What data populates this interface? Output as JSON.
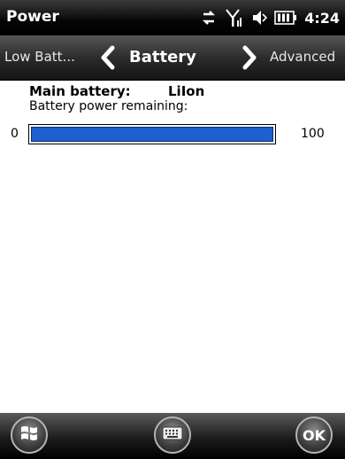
{
  "titlebar": {
    "title": "Power",
    "clock": "4:24",
    "icons": [
      "sync-icon",
      "signal-icon",
      "volume-icon",
      "battery-icon"
    ]
  },
  "tabs": {
    "previous": "Low Batt...",
    "current": "Battery",
    "next": "Advanced"
  },
  "battery": {
    "main_label": "Main battery:",
    "main_value": "LiIon",
    "remaining_label": "Battery power remaining:",
    "scale_min": "0",
    "scale_max": "100",
    "remaining_level": 1.0
  },
  "softkeys": {
    "ok_label": "OK",
    "icons": [
      "windows-start-icon",
      "keyboard-icon"
    ]
  },
  "colors": {
    "progress_fill": "#1f5fcf"
  }
}
